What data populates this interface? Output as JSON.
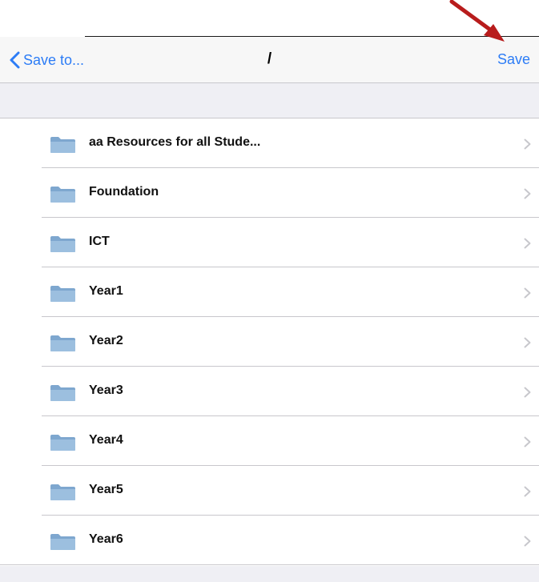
{
  "navbar": {
    "back_label": "Save to...",
    "title": "/",
    "save_label": "Save"
  },
  "folders": [
    {
      "label": "aa Resources for all Stude..."
    },
    {
      "label": "Foundation"
    },
    {
      "label": "ICT"
    },
    {
      "label": "Year1"
    },
    {
      "label": "Year2"
    },
    {
      "label": "Year3"
    },
    {
      "label": "Year4"
    },
    {
      "label": "Year5"
    },
    {
      "label": "Year6"
    }
  ],
  "icons": {
    "back": "chevron-left-icon",
    "folder": "folder-icon",
    "disclosure": "chevron-right-icon",
    "annotation": "red-arrow-icon"
  },
  "colors": {
    "accent": "#2c7cf6",
    "annotation_arrow": "#b81c1c",
    "folder": "#8fb3d6",
    "separator": "#c8c7cc",
    "group_background": "#efeff4"
  }
}
